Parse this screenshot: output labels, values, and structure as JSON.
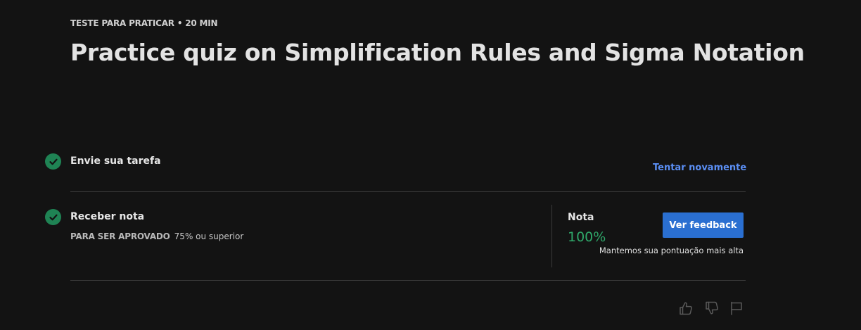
{
  "header": {
    "kicker": "TESTE PARA PRATICAR • 20 MIN",
    "title": "Practice quiz on Simplification Rules and Sigma Notation"
  },
  "steps": [
    {
      "title": "Envie sua tarefa",
      "status": "complete",
      "action_label": "Tentar novamente"
    },
    {
      "title": "Receber nota",
      "status": "complete",
      "pass_label": "PARA SER APROVADO",
      "pass_value": "75% ou superior"
    }
  ],
  "grade": {
    "label": "Nota",
    "value": "100%",
    "button_label": "Ver feedback",
    "note": "Mantemos sua pontuação mais alta"
  },
  "footer_icons": [
    "like-icon",
    "dislike-icon",
    "flag-icon"
  ],
  "colors": {
    "background": "#131313",
    "check": "#1f8354",
    "link": "#5b8ff5",
    "button": "#2a6fd1",
    "grade": "#2fa86a"
  }
}
